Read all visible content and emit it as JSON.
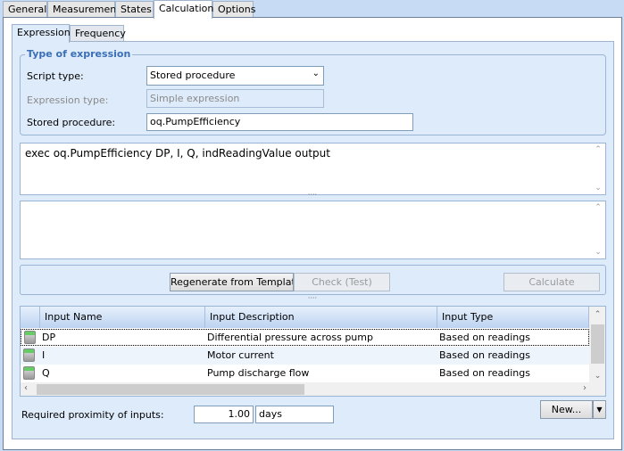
{
  "top_tabs": [
    "General",
    "Measurement",
    "States",
    "Calculation",
    "Options"
  ],
  "inner_tabs": [
    "Expression",
    "Frequency"
  ],
  "group_title": "Type of expression",
  "script_type": {
    "label": "Script type:",
    "value": "Stored procedure"
  },
  "expression_type": {
    "label": "Expression type:",
    "value": "Simple expression"
  },
  "stored_procedure": {
    "label": "Stored procedure:",
    "value": "oq.PumpEfficiency"
  },
  "expression_text": "exec oq.PumpEfficiency DP, I, Q, indReadingValue output",
  "buttons": {
    "regenerate": "Regenerate from Template",
    "check": "Check (Test)",
    "calculate": "Calculate",
    "new": "New..."
  },
  "grid": {
    "columns": [
      "Input Name",
      "Input Description",
      "Input Type"
    ],
    "rows": [
      {
        "name": "DP",
        "description": "Differential pressure across pump",
        "type": "Based on readings"
      },
      {
        "name": "I",
        "description": "Motor current",
        "type": "Based on readings"
      },
      {
        "name": "Q",
        "description": "Pump discharge flow",
        "type": "Based on readings"
      }
    ]
  },
  "proximity": {
    "label": "Required proximity of inputs:",
    "value": "1.00",
    "unit": "days"
  }
}
